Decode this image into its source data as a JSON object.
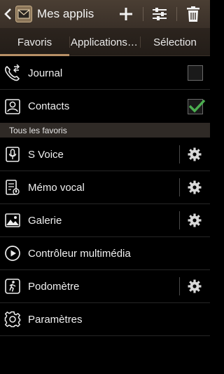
{
  "actionbar": {
    "title": "Mes applis",
    "icons": [
      "back-icon",
      "mail-app-icon",
      "add-icon",
      "sliders-icon",
      "trash-icon"
    ]
  },
  "tabs": [
    {
      "label": "Favoris",
      "active": true
    },
    {
      "label": "Applications disponibles",
      "active": false
    },
    {
      "label": "Sélection",
      "active": false
    }
  ],
  "top_items": [
    {
      "label": "Journal",
      "icon": "call-log-icon",
      "checked": false
    },
    {
      "label": "Contacts",
      "icon": "contacts-icon",
      "checked": true
    }
  ],
  "section": {
    "label": "Tous les favoris"
  },
  "favorites": [
    {
      "label": "S Voice",
      "icon": "microphone-icon",
      "settings": true
    },
    {
      "label": "Mémo vocal",
      "icon": "voice-memo-icon",
      "settings": true
    },
    {
      "label": "Galerie",
      "icon": "gallery-icon",
      "settings": true
    },
    {
      "label": "Contrôleur multimédia",
      "icon": "play-icon",
      "settings": false
    },
    {
      "label": "Podomètre",
      "icon": "pedometer-icon",
      "settings": true
    },
    {
      "label": "Paramètres",
      "icon": "settings-icon",
      "settings": false
    }
  ],
  "colors": {
    "check": "#4caf50",
    "accent": "#b89066"
  }
}
